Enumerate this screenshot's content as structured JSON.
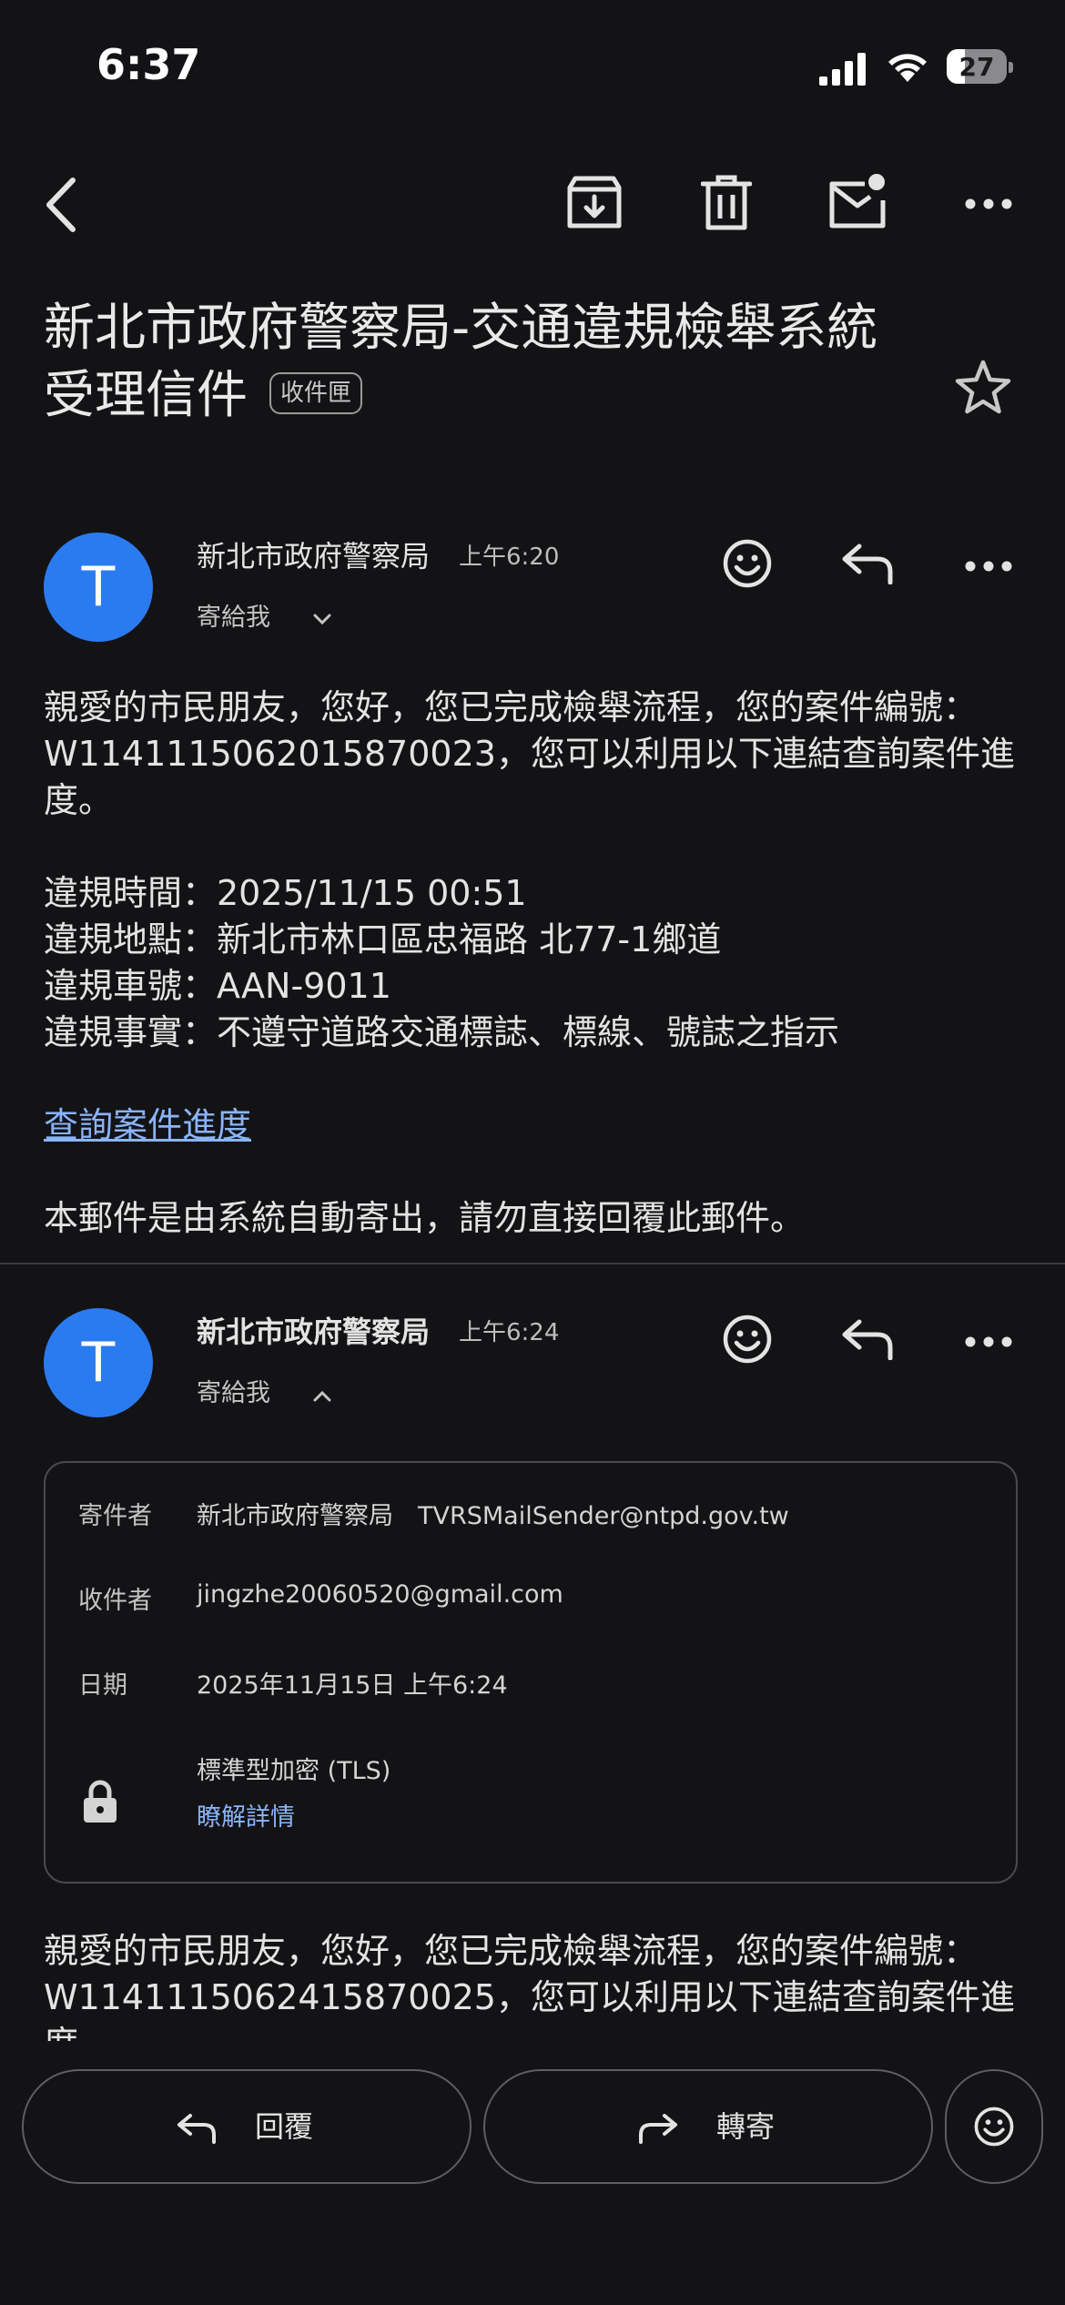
{
  "status_bar": {
    "time": "6:37",
    "battery": "27"
  },
  "toolbar": {
    "back": "back-arrow-icon",
    "archive": "archive-icon",
    "delete": "trash-icon",
    "mark_unread": "mail-unread-icon",
    "more": "more-horizontal-icon"
  },
  "email": {
    "subject_line1": "新北市政府警察局-交通違規檢舉系統",
    "subject_line2": "受理信件",
    "folder_chip": "收件匣"
  },
  "messages": [
    {
      "avatar_letter": "T",
      "sender": "新北市政府警察局",
      "time": "上午6:20",
      "to": "寄給我",
      "body_line1": "親愛的市民朋友，您好，您已完成檢舉流程，您的案件編號：",
      "body_line2": "W1141115062015870023，您可以利用以下連結查詢案件進",
      "body_line3": "度。",
      "violation_time": "違規時間：2025/11/15 00:51",
      "violation_place": "違規地點：新北市林口區忠福路 北77-1鄉道",
      "violation_plate": "違規車號：AAN-9011",
      "violation_fact": "違規事實：不遵守道路交通標誌、標線、號誌之指示",
      "link": "查詢案件進度",
      "footer": "本郵件是由系統自動寄出，請勿直接回覆此郵件。"
    },
    {
      "avatar_letter": "T",
      "sender": "新北市政府警察局",
      "time": "上午6:24",
      "to": "寄給我",
      "details": {
        "from_label": "寄件者",
        "from_value": "新北市政府警察局　TVRSMailSender@ntpd.gov.tw",
        "to_label": "收件者",
        "to_value": "jingzhe20060520@gmail.com",
        "date_label": "日期",
        "date_value": "2025年11月15日 上午6:24",
        "encryption": "標準型加密 (TLS)",
        "learn_more": "瞭解詳情"
      },
      "body_line1": "親愛的市民朋友，您好，您已完成檢舉流程，您的案件編號：",
      "body_line2": "W1141115062415870025，您可以利用以下連結查詢案件進",
      "body_line3": "度。"
    }
  ],
  "bottom_bar": {
    "reply": "回覆",
    "forward": "轉寄"
  },
  "colors": {
    "background": "#131316",
    "accent": "#2b7bf0",
    "link": "#8ab4f8"
  }
}
